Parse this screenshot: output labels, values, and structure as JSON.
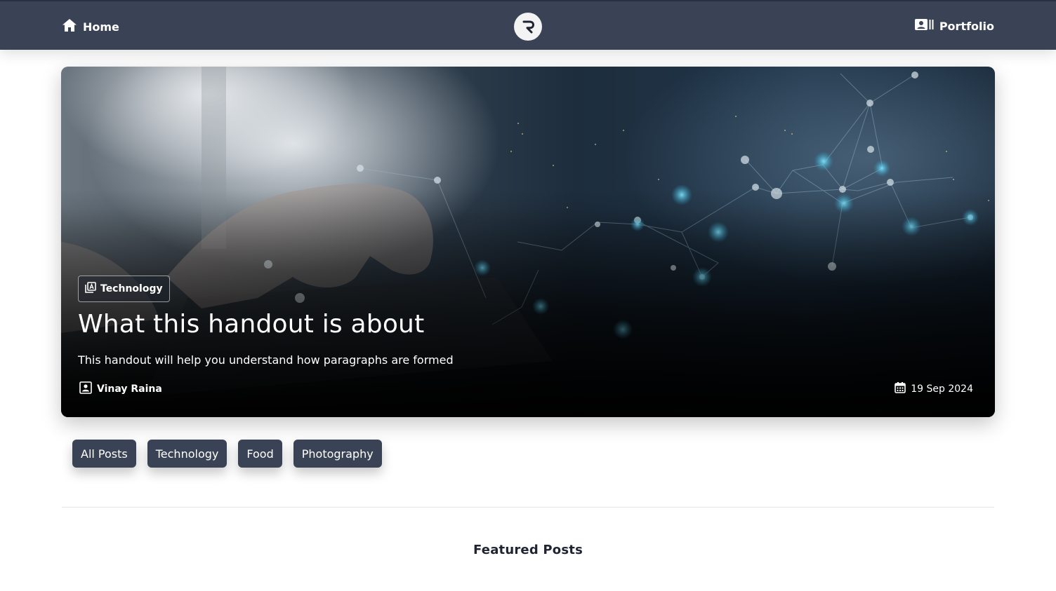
{
  "nav": {
    "home_label": "Home",
    "portfolio_label": "Portfolio",
    "logo_letter": "R"
  },
  "hero": {
    "category": "Technology",
    "title": "What this handout is about",
    "subtitle": "This handout will help you understand how paragraphs are formed",
    "author": "Vinay Raina",
    "date": "19 Sep 2024"
  },
  "filters": [
    "All Posts",
    "Technology",
    "Food",
    "Photography"
  ],
  "section": {
    "title": "Featured Posts"
  },
  "colors": {
    "navbar": "#3a4355",
    "button": "#3a4355",
    "text": "#1f2430"
  },
  "icons": {
    "home": "home-icon",
    "portfolio": "portfolio-icon",
    "category": "article-icon",
    "author": "person-icon",
    "date": "calendar-icon"
  }
}
